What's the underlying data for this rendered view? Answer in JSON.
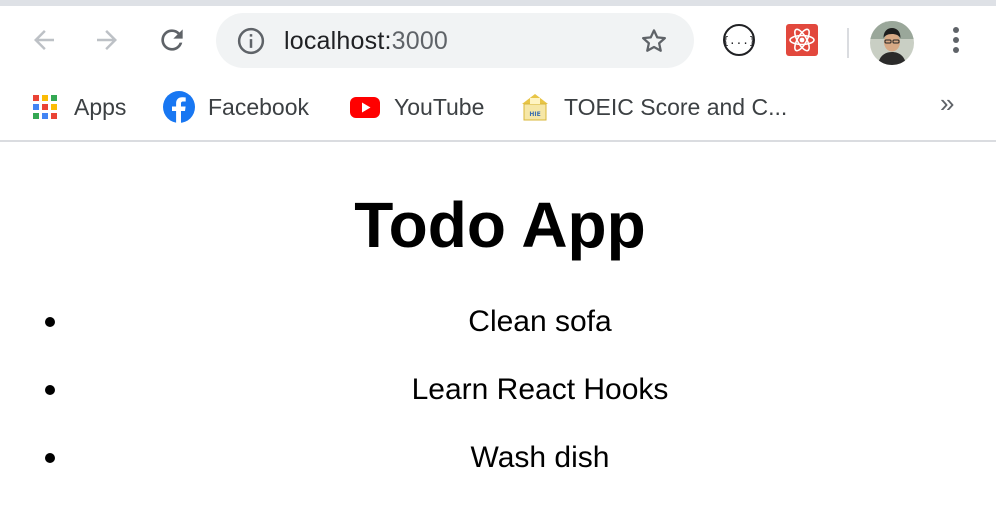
{
  "browser": {
    "url_host": "localhost:",
    "url_port": "3000"
  },
  "bookmarks": [
    {
      "label": "Apps",
      "icon": "apps-grid-icon"
    },
    {
      "label": "Facebook",
      "icon": "facebook-icon"
    },
    {
      "label": "YouTube",
      "icon": "youtube-icon"
    },
    {
      "label": "TOEIC Score and C...",
      "icon": "toeic-icon"
    }
  ],
  "bookmarks_overflow": "»",
  "page": {
    "title": "Todo App",
    "todos": [
      {
        "text": "Clean sofa"
      },
      {
        "text": "Learn React Hooks"
      },
      {
        "text": "Wash dish"
      }
    ]
  },
  "colors": {
    "omnibox_bg": "#f1f3f4",
    "tab_strip": "#dee1e6",
    "youtube_red": "#ff0000",
    "facebook_blue": "#1877f2"
  }
}
